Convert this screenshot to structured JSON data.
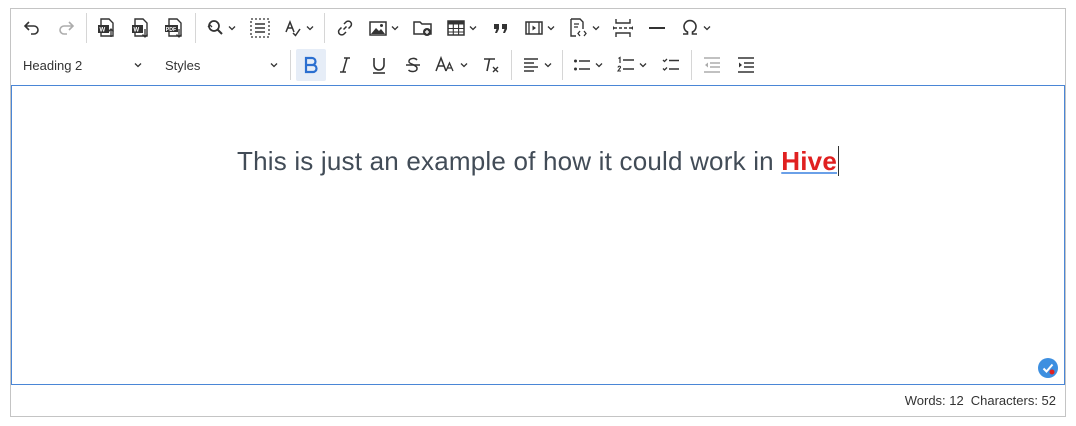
{
  "toolbar": {
    "heading_select": {
      "value": "Heading 2"
    },
    "styles_select": {
      "value": "Styles"
    }
  },
  "content": {
    "heading_text": "This is just an example of how it could work in ",
    "highlight_word": "Hive"
  },
  "status_bar": {
    "words": "Words: 12",
    "characters": "Characters: 52"
  },
  "colors": {
    "accent_border": "#4a86d6",
    "highlight": "#e02020",
    "bold_active_bg": "#e6edf7"
  },
  "icons": [
    "undo-icon",
    "redo-icon",
    "import-word-icon",
    "export-word-icon",
    "export-pdf-icon",
    "find-replace-icon",
    "select-all-icon",
    "spellcheck-icon",
    "link-icon",
    "image-icon",
    "file-manager-icon",
    "table-icon",
    "blockquote-icon",
    "media-embed-icon",
    "source-code-icon",
    "page-break-icon",
    "horizontal-line-icon",
    "special-characters-icon",
    "bold-icon",
    "italic-icon",
    "underline-icon",
    "strikethrough-icon",
    "font-size-icon",
    "remove-format-icon",
    "align-icon",
    "bulleted-list-icon",
    "numbered-list-icon",
    "todo-list-icon",
    "outdent-icon",
    "indent-icon",
    "spellcheck-badge-icon"
  ]
}
